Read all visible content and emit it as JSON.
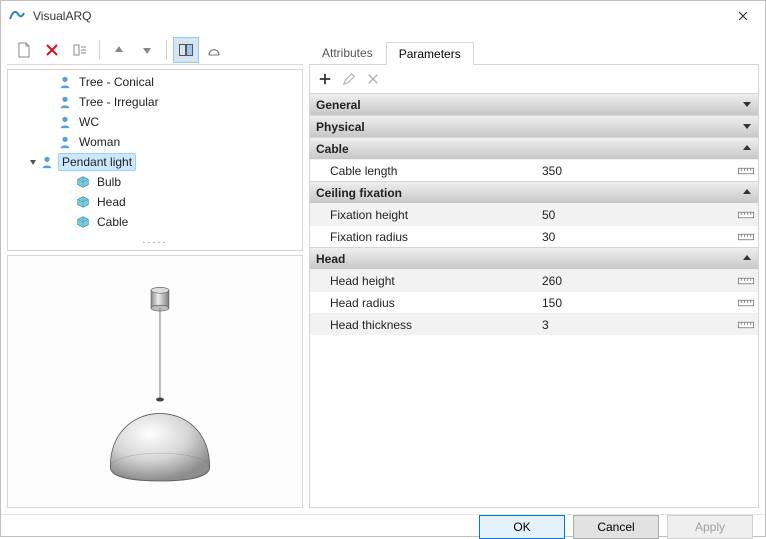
{
  "window": {
    "title": "VisualARQ"
  },
  "tree": {
    "items": [
      {
        "label": "Tree - Conical",
        "depth": 2,
        "icon": "person",
        "selected": false,
        "expander": "none"
      },
      {
        "label": "Tree - Irregular",
        "depth": 2,
        "icon": "person",
        "selected": false,
        "expander": "none"
      },
      {
        "label": "WC",
        "depth": 2,
        "icon": "person",
        "selected": false,
        "expander": "none"
      },
      {
        "label": "Woman",
        "depth": 2,
        "icon": "person",
        "selected": false,
        "expander": "none"
      },
      {
        "label": "Pendant light",
        "depth": 1,
        "icon": "person",
        "selected": true,
        "expander": "open"
      },
      {
        "label": "Bulb",
        "depth": 3,
        "icon": "cube",
        "selected": false,
        "expander": "none"
      },
      {
        "label": "Head",
        "depth": 3,
        "icon": "cube",
        "selected": false,
        "expander": "none"
      },
      {
        "label": "Cable",
        "depth": 3,
        "icon": "cube",
        "selected": false,
        "expander": "none"
      }
    ],
    "ellipsis": "....."
  },
  "tabs": {
    "attributes_label": "Attributes",
    "parameters_label": "Parameters",
    "active": "parameters"
  },
  "groups": [
    {
      "name": "General",
      "state": "collapsed",
      "rows": []
    },
    {
      "name": "Physical",
      "state": "collapsed",
      "rows": []
    },
    {
      "name": "Cable",
      "state": "open",
      "rows": [
        {
          "name": "Cable length",
          "value": "350",
          "unit": "mm"
        }
      ]
    },
    {
      "name": "Ceiling fixation",
      "state": "open",
      "rows": [
        {
          "name": "Fixation height",
          "value": "50",
          "unit": "mm"
        },
        {
          "name": "Fixation radius",
          "value": "30",
          "unit": "mm"
        }
      ]
    },
    {
      "name": "Head",
      "state": "open",
      "rows": [
        {
          "name": "Head height",
          "value": "260",
          "unit": "mm"
        },
        {
          "name": "Head radius",
          "value": "150",
          "unit": "mm"
        },
        {
          "name": "Head thickness",
          "value": "3",
          "unit": "mm"
        }
      ]
    }
  ],
  "footer": {
    "ok": "OK",
    "cancel": "Cancel",
    "apply": "Apply"
  }
}
